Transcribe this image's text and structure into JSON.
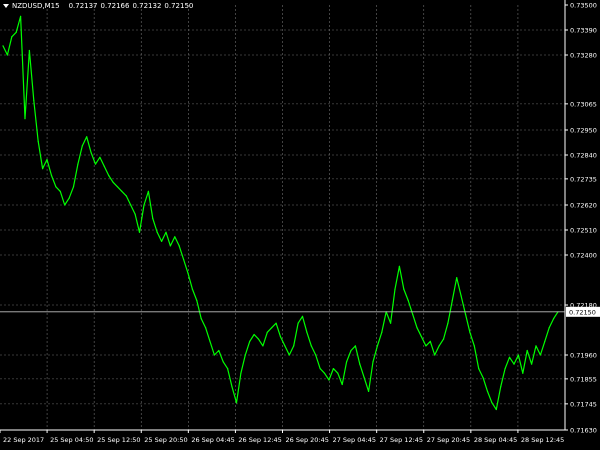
{
  "header": {
    "symbol": "NZDUSD,M15",
    "open": "0.72137",
    "high": "0.72166",
    "low": "0.72132",
    "close": "0.72150",
    "menu_icon": "triangle-down-icon"
  },
  "colors": {
    "background": "#000000",
    "candles": "#00ff00",
    "grid": "#6e6e6e",
    "axis": "#ffffff",
    "bid_line": "#c0c0c0",
    "bid_label_bg": "#ffffff",
    "bid_label_text": "#000000"
  },
  "price_axis": {
    "labels": [
      "0.73500",
      "0.73390",
      "0.73280",
      "0.73065",
      "0.72950",
      "0.72840",
      "0.72735",
      "0.72620",
      "0.72510",
      "0.72400",
      "0.72180",
      "0.71960",
      "0.71855",
      "0.71745",
      "0.71630"
    ],
    "current_label": "0.72150"
  },
  "time_axis": {
    "labels": [
      "22 Sep 2017",
      "25 Sep 04:50",
      "25 Sep 12:50",
      "25 Sep 20:50",
      "26 Sep 04:45",
      "26 Sep 12:45",
      "26 Sep 20:45",
      "27 Sep 04:45",
      "27 Sep 12:45",
      "27 Sep 20:45",
      "28 Sep 04:45",
      "28 Sep 12:45"
    ]
  },
  "chart_data": {
    "type": "line",
    "x_range": [
      "22 Sep 2017",
      "28 Sep 12:45"
    ],
    "ylim": [
      0.7163,
      0.735
    ],
    "current_price": 0.7215,
    "grid": true,
    "series": [
      {
        "values": [
          0.7332,
          0.7328,
          0.7336,
          0.7338,
          0.7345,
          0.73,
          0.733,
          0.7308,
          0.729,
          0.7278,
          0.7282,
          0.7275,
          0.727,
          0.7268,
          0.7262,
          0.7265,
          0.727,
          0.728,
          0.7288,
          0.7292,
          0.7285,
          0.728,
          0.7283,
          0.7279,
          0.7275,
          0.7272,
          0.727,
          0.7268,
          0.7266,
          0.7262,
          0.7258,
          0.725,
          0.7262,
          0.7268,
          0.7256,
          0.725,
          0.7246,
          0.725,
          0.7244,
          0.7248,
          0.7244,
          0.7238,
          0.7232,
          0.7225,
          0.722,
          0.7212,
          0.7208,
          0.7202,
          0.7196,
          0.7198,
          0.7193,
          0.719,
          0.7182,
          0.7175,
          0.7188,
          0.7196,
          0.7202,
          0.7205,
          0.7203,
          0.72,
          0.7206,
          0.7208,
          0.721,
          0.7204,
          0.72,
          0.7196,
          0.72,
          0.721,
          0.7213,
          0.7206,
          0.72,
          0.7196,
          0.719,
          0.7188,
          0.7185,
          0.719,
          0.7188,
          0.7183,
          0.7193,
          0.7198,
          0.72,
          0.7192,
          0.7186,
          0.718,
          0.7193,
          0.72,
          0.7206,
          0.7215,
          0.721,
          0.7225,
          0.7235,
          0.7225,
          0.722,
          0.7214,
          0.7208,
          0.7204,
          0.72,
          0.7202,
          0.7196,
          0.72,
          0.7203,
          0.721,
          0.722,
          0.723,
          0.7222,
          0.7214,
          0.7206,
          0.72,
          0.719,
          0.7186,
          0.718,
          0.7175,
          0.7172,
          0.7182,
          0.719,
          0.7195,
          0.7192,
          0.7196,
          0.7188,
          0.7198,
          0.7192,
          0.72,
          0.7196,
          0.7202,
          0.7208,
          0.7212,
          0.7215
        ]
      }
    ]
  }
}
